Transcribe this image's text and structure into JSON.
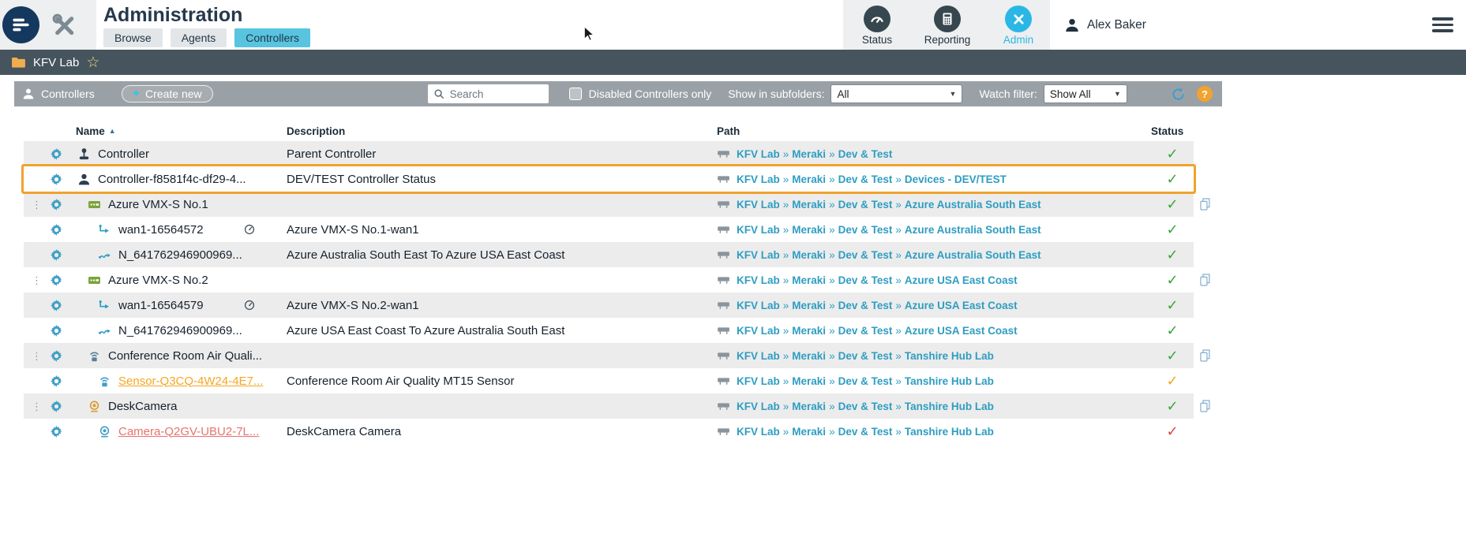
{
  "colors": {
    "accent": "#2bb7e5",
    "tab_active": "#58c4e0",
    "topbar_icon_bg": "#37474f",
    "link": "#2e9dc2",
    "ok": "#3aa535",
    "warning": "#f5a623",
    "alert": "#d9453c",
    "highlight": "#f0a32e",
    "gear": "#3f9fc6"
  },
  "header": {
    "title": "Administration",
    "tabs": [
      {
        "label": "Browse",
        "active": false
      },
      {
        "label": "Agents",
        "active": false
      },
      {
        "label": "Controllers",
        "active": true
      }
    ],
    "actions": [
      {
        "label": "Status",
        "active": false
      },
      {
        "label": "Reporting",
        "active": false
      },
      {
        "label": "Admin",
        "active": true
      }
    ],
    "user": {
      "name": "Alex Baker"
    }
  },
  "breadcrumb": {
    "location": "KFV Lab"
  },
  "toolbar": {
    "section_label": "Controllers",
    "create_label": "Create new",
    "search_placeholder": "Search",
    "search_value": "",
    "disabled_only_label": "Disabled Controllers only",
    "disabled_only_checked": false,
    "subfolders_label": "Show in subfolders:",
    "subfolders_value": "All",
    "watch_label": "Watch filter:",
    "watch_value": "Show All"
  },
  "table": {
    "columns": [
      "Name",
      "Description",
      "Path",
      "Status"
    ],
    "sort": {
      "column": "Name",
      "direction": "asc"
    },
    "path_separator": "»",
    "rows": [
      {
        "name": "Controller",
        "icon": "joystick",
        "icon_color": "#2c3e50",
        "indent": 0,
        "description": "Parent Controller",
        "path": [
          "KFV Lab",
          "Meraki",
          "Dev & Test"
        ],
        "status": "ok",
        "handle": false,
        "copy": false,
        "gauge": false,
        "highlighted": false
      },
      {
        "name": "Controller-f8581f4c-df29-4...",
        "icon": "person",
        "icon_color": "#2c3e50",
        "indent": 0,
        "description": "DEV/TEST Controller Status",
        "path": [
          "KFV Lab",
          "Meraki",
          "Dev & Test",
          "Devices - DEV/TEST"
        ],
        "status": "ok",
        "handle": false,
        "copy": false,
        "gauge": false,
        "highlighted": true
      },
      {
        "name": "Azure VMX-S No.1",
        "icon": "appliance",
        "icon_color": "#7aa33c",
        "indent": 1,
        "description": "",
        "path": [
          "KFV Lab",
          "Meraki",
          "Dev & Test",
          "Azure Australia South East"
        ],
        "status": "ok",
        "handle": true,
        "copy": true,
        "gauge": false,
        "highlighted": false
      },
      {
        "name": "wan1-16564572",
        "icon": "wan",
        "icon_color": "#2f9ec4",
        "indent": 2,
        "description": "Azure VMX-S No.1-wan1",
        "path": [
          "KFV Lab",
          "Meraki",
          "Dev & Test",
          "Azure Australia South East"
        ],
        "status": "ok",
        "handle": false,
        "copy": false,
        "gauge": true,
        "highlighted": false
      },
      {
        "name": "N_641762946900969...",
        "icon": "network",
        "icon_color": "#2f9ec4",
        "indent": 2,
        "description": "Azure Australia South East To Azure USA East Coast",
        "path": [
          "KFV Lab",
          "Meraki",
          "Dev & Test",
          "Azure Australia South East"
        ],
        "status": "ok",
        "handle": false,
        "copy": false,
        "gauge": false,
        "highlighted": false
      },
      {
        "name": "Azure VMX-S No.2",
        "icon": "appliance",
        "icon_color": "#7aa33c",
        "indent": 1,
        "description": "",
        "path": [
          "KFV Lab",
          "Meraki",
          "Dev & Test",
          "Azure USA East Coast"
        ],
        "status": "ok",
        "handle": true,
        "copy": true,
        "gauge": false,
        "highlighted": false
      },
      {
        "name": "wan1-16564579",
        "icon": "wan",
        "icon_color": "#2f9ec4",
        "indent": 2,
        "description": "Azure VMX-S No.2-wan1",
        "path": [
          "KFV Lab",
          "Meraki",
          "Dev & Test",
          "Azure USA East Coast"
        ],
        "status": "ok",
        "handle": false,
        "copy": false,
        "gauge": true,
        "highlighted": false
      },
      {
        "name": "N_641762946900969...",
        "icon": "network",
        "icon_color": "#2f9ec4",
        "indent": 2,
        "description": "Azure USA East Coast To Azure Australia South East",
        "path": [
          "KFV Lab",
          "Meraki",
          "Dev & Test",
          "Azure USA East Coast"
        ],
        "status": "ok",
        "handle": false,
        "copy": false,
        "gauge": false,
        "highlighted": false
      },
      {
        "name": "Conference Room Air Quali...",
        "icon": "sensor",
        "icon_color": "#5b7f99",
        "indent": 1,
        "description": "",
        "path": [
          "KFV Lab",
          "Meraki",
          "Dev & Test",
          "Tanshire Hub Lab"
        ],
        "status": "ok",
        "handle": true,
        "copy": true,
        "gauge": false,
        "highlighted": false
      },
      {
        "name": "Sensor-Q3CQ-4W24-4E7...",
        "icon": "sensor",
        "icon_color": "#3f9fc6",
        "indent": 2,
        "name_color": "#f5a623",
        "underline": true,
        "description": "Conference Room Air Quality MT15 Sensor",
        "path": [
          "KFV Lab",
          "Meraki",
          "Dev & Test",
          "Tanshire Hub Lab"
        ],
        "status": "warning",
        "handle": false,
        "copy": false,
        "gauge": false,
        "highlighted": false
      },
      {
        "name": "DeskCamera",
        "icon": "camera",
        "icon_color": "#d79b2e",
        "indent": 1,
        "description": "",
        "path": [
          "KFV Lab",
          "Meraki",
          "Dev & Test",
          "Tanshire Hub Lab"
        ],
        "status": "ok",
        "handle": true,
        "copy": true,
        "gauge": false,
        "highlighted": false
      },
      {
        "name": "Camera-Q2GV-UBU2-7L...",
        "icon": "camera",
        "icon_color": "#3f9fc6",
        "indent": 2,
        "name_color": "#e8736b",
        "underline": true,
        "description": "DeskCamera Camera",
        "path": [
          "KFV Lab",
          "Meraki",
          "Dev & Test",
          "Tanshire Hub Lab"
        ],
        "status": "alert",
        "handle": false,
        "copy": false,
        "gauge": false,
        "highlighted": false
      }
    ]
  }
}
